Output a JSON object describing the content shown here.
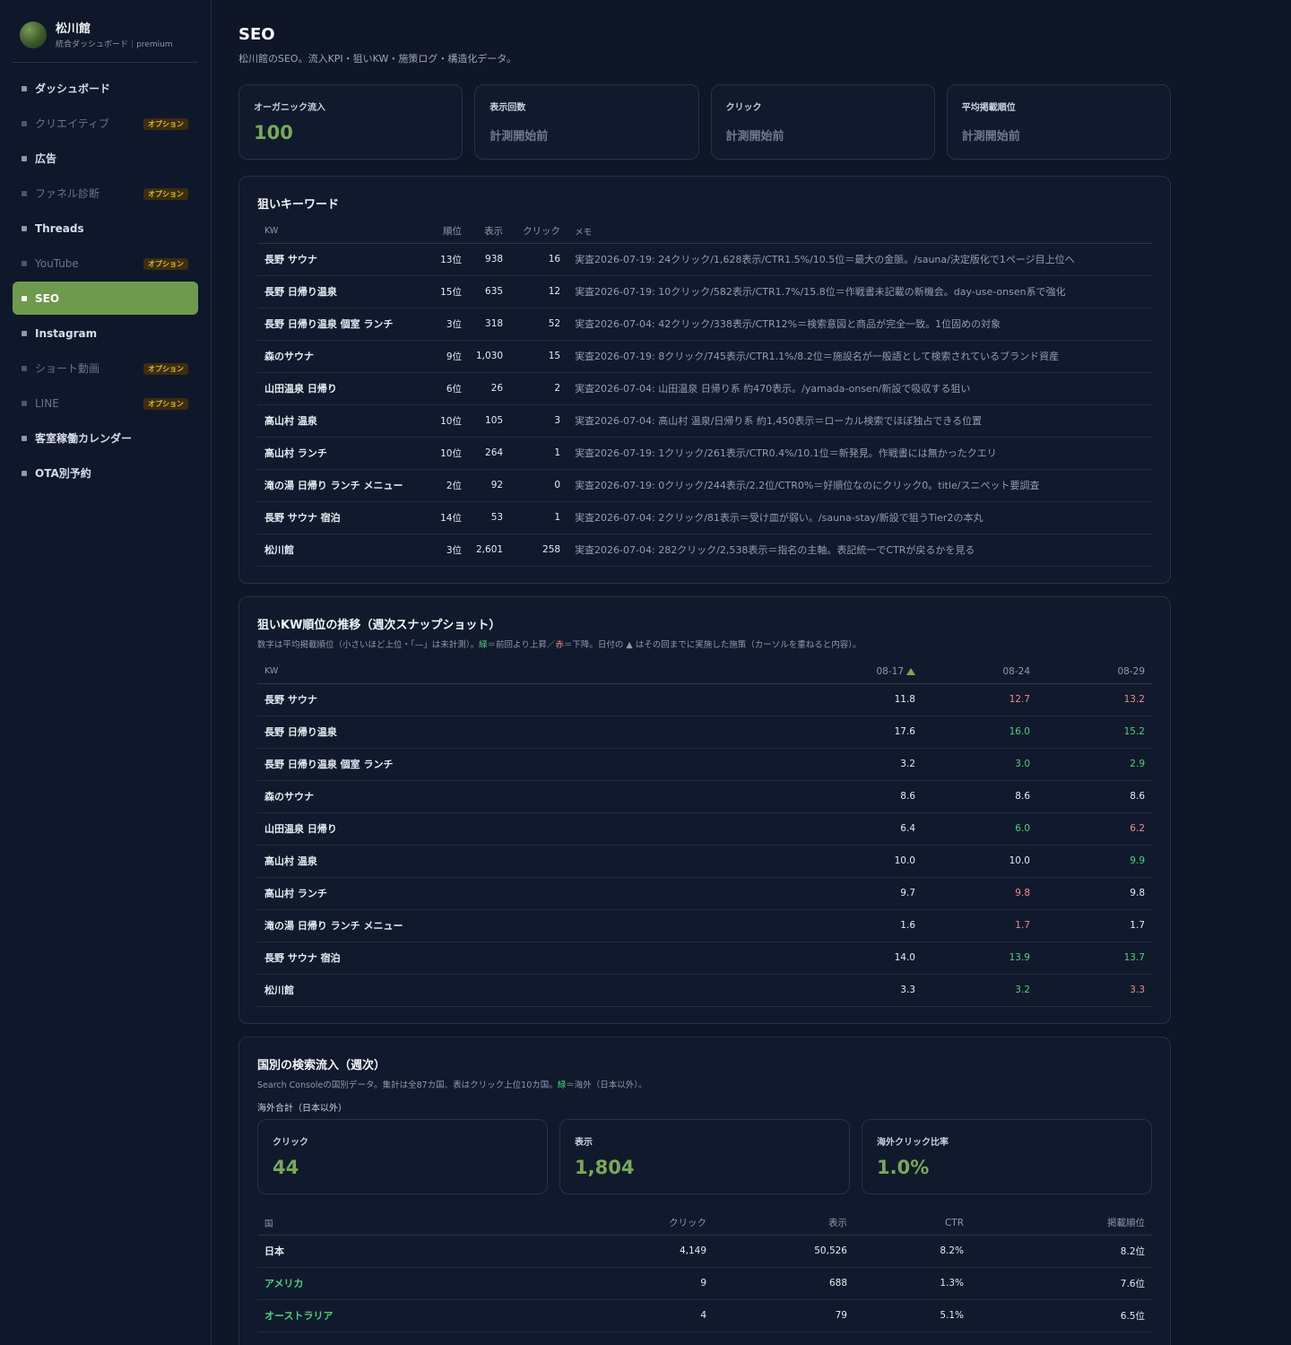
{
  "brand": {
    "name": "松川館",
    "sub": "統合ダッシュボード",
    "plan": "premium"
  },
  "nav": [
    {
      "label": "ダッシュボード",
      "dim": false,
      "active": false
    },
    {
      "label": "クリエイティブ",
      "dim": true,
      "active": false,
      "badge": "オプション"
    },
    {
      "label": "広告",
      "dim": false,
      "active": false
    },
    {
      "label": "ファネル診断",
      "dim": true,
      "active": false,
      "badge": "オプション"
    },
    {
      "label": "Threads",
      "dim": false,
      "active": false
    },
    {
      "label": "YouTube",
      "dim": true,
      "active": false,
      "badge": "オプション"
    },
    {
      "label": "SEO",
      "dim": false,
      "active": true
    },
    {
      "label": "Instagram",
      "dim": false,
      "active": false
    },
    {
      "label": "ショート動画",
      "dim": true,
      "active": false,
      "badge": "オプション"
    },
    {
      "label": "LINE",
      "dim": true,
      "active": false,
      "badge": "オプション"
    },
    {
      "label": "客室稼働カレンダー",
      "dim": false,
      "active": false
    },
    {
      "label": "OTA別予約",
      "dim": false,
      "active": false
    }
  ],
  "page": {
    "title": "SEO",
    "description": "松川館のSEO。流入KPI・狙いKW・施策ログ・構造化データ。"
  },
  "kpis": [
    {
      "label": "オーガニック流入",
      "value": "100",
      "muted": false
    },
    {
      "label": "表示回数",
      "value": "計測開始前",
      "muted": true
    },
    {
      "label": "クリック",
      "value": "計測開始前",
      "muted": true
    },
    {
      "label": "平均掲載順位",
      "value": "計測開始前",
      "muted": true
    }
  ],
  "keywords": {
    "title": "狙いキーワード",
    "headers": {
      "kw": "KW",
      "rank": "順位",
      "impr": "表示",
      "click": "クリック",
      "memo": "メモ"
    },
    "rows": [
      {
        "kw": "長野 サウナ",
        "rank": "13位",
        "impr": "938",
        "click": "16",
        "memo": "実査2026-07-19: 24クリック/1,628表示/CTR1.5%/10.5位＝最大の金脈。/sauna/決定版化で1ページ目上位へ"
      },
      {
        "kw": "長野 日帰り温泉",
        "rank": "15位",
        "impr": "635",
        "click": "12",
        "memo": "実査2026-07-19: 10クリック/582表示/CTR1.7%/15.8位＝作戦書未記載の新機会。day-use-onsen系で強化"
      },
      {
        "kw": "長野 日帰り温泉 個室 ランチ",
        "rank": "3位",
        "impr": "318",
        "click": "52",
        "memo": "実査2026-07-04: 42クリック/338表示/CTR12%＝検索意図と商品が完全一致。1位固めの対象"
      },
      {
        "kw": "森のサウナ",
        "rank": "9位",
        "impr": "1,030",
        "click": "15",
        "memo": "実査2026-07-19: 8クリック/745表示/CTR1.1%/8.2位＝施設名が一般語として検索されているブランド資産"
      },
      {
        "kw": "山田温泉 日帰り",
        "rank": "6位",
        "impr": "26",
        "click": "2",
        "memo": "実査2026-07-04: 山田温泉 日帰り系 約470表示。/yamada-onsen/新設で吸収する狙い"
      },
      {
        "kw": "高山村 温泉",
        "rank": "10位",
        "impr": "105",
        "click": "3",
        "memo": "実査2026-07-04: 高山村 温泉/日帰り系 約1,450表示＝ローカル検索でほぼ独占できる位置"
      },
      {
        "kw": "高山村 ランチ",
        "rank": "10位",
        "impr": "264",
        "click": "1",
        "memo": "実査2026-07-19: 1クリック/261表示/CTR0.4%/10.1位＝新発見。作戦書には無かったクエリ"
      },
      {
        "kw": "滝の湯 日帰り ランチ メニュー",
        "rank": "2位",
        "impr": "92",
        "click": "0",
        "memo": "実査2026-07-19: 0クリック/244表示/2.2位/CTR0%＝好順位なのにクリック0。title/スニペット要調査"
      },
      {
        "kw": "長野 サウナ 宿泊",
        "rank": "14位",
        "impr": "53",
        "click": "1",
        "memo": "実査2026-07-04: 2クリック/81表示＝受け皿が弱い。/sauna-stay/新設で狙うTier2の本丸"
      },
      {
        "kw": "松川館",
        "rank": "3位",
        "impr": "2,601",
        "click": "258",
        "memo": "実査2026-07-04: 282クリック/2,538表示＝指名の主軸。表記統一でCTRが戻るかを見る"
      }
    ]
  },
  "trend": {
    "title": "狙いKW順位の推移（週次スナップショット）",
    "desc_pre": "数字は平均掲載順位（小さいほど上位・「—」は未計測）。",
    "desc_green": "緑",
    "desc_mid": "＝前回より上昇／",
    "desc_red": "赤",
    "desc_post": "＝下降。日付の ▲ はその回までに実施した施策（カーソルを重ねると内容）。",
    "headers": {
      "kw": "KW",
      "d1": "08-17",
      "d2": "08-24",
      "d3": "08-29"
    },
    "rows": [
      {
        "kw": "長野 サウナ",
        "v1": "11.8",
        "v2": "12.7",
        "c2": "down",
        "v3": "13.2",
        "c3": "down"
      },
      {
        "kw": "長野 日帰り温泉",
        "v1": "17.6",
        "v2": "16.0",
        "c2": "up",
        "v3": "15.2",
        "c3": "up"
      },
      {
        "kw": "長野 日帰り温泉 個室 ランチ",
        "v1": "3.2",
        "v2": "3.0",
        "c2": "up",
        "v3": "2.9",
        "c3": "up"
      },
      {
        "kw": "森のサウナ",
        "v1": "8.6",
        "v2": "8.6",
        "c2": "",
        "v3": "8.6",
        "c3": ""
      },
      {
        "kw": "山田温泉 日帰り",
        "v1": "6.4",
        "v2": "6.0",
        "c2": "up",
        "v3": "6.2",
        "c3": "down"
      },
      {
        "kw": "高山村 温泉",
        "v1": "10.0",
        "v2": "10.0",
        "c2": "",
        "v3": "9.9",
        "c3": "up"
      },
      {
        "kw": "高山村 ランチ",
        "v1": "9.7",
        "v2": "9.8",
        "c2": "down",
        "v3": "9.8",
        "c3": ""
      },
      {
        "kw": "滝の湯 日帰り ランチ メニュー",
        "v1": "1.6",
        "v2": "1.7",
        "c2": "down",
        "v3": "1.7",
        "c3": ""
      },
      {
        "kw": "長野 サウナ 宿泊",
        "v1": "14.0",
        "v2": "13.9",
        "c2": "up",
        "v3": "13.7",
        "c3": "up"
      },
      {
        "kw": "松川館",
        "v1": "3.3",
        "v2": "3.2",
        "c2": "up",
        "v3": "3.3",
        "c3": "down"
      }
    ]
  },
  "country": {
    "title": "国別の検索流入（週次）",
    "desc_pre": "Search Consoleの国別データ。集計は全87カ国、表はクリック上位10カ国。",
    "desc_green": "緑",
    "desc_post": "＝海外（日本以外）。",
    "overseas_label": "海外合計（日本以外）",
    "kpis": [
      {
        "label": "クリック",
        "value": "44"
      },
      {
        "label": "表示",
        "value": "1,804"
      },
      {
        "label": "海外クリック比率",
        "value": "1.0%"
      }
    ],
    "headers": {
      "country": "国",
      "click": "クリック",
      "impr": "表示",
      "ctr": "CTR",
      "pos": "掲載順位"
    },
    "rows": [
      {
        "country": "日本",
        "overseas": false,
        "click": "4,149",
        "impr": "50,526",
        "ctr": "8.2%",
        "pos": "8.2位"
      },
      {
        "country": "アメリカ",
        "overseas": true,
        "click": "9",
        "impr": "688",
        "ctr": "1.3%",
        "pos": "7.6位"
      },
      {
        "country": "オーストラリア",
        "overseas": true,
        "click": "4",
        "impr": "79",
        "ctr": "5.1%",
        "pos": "6.5位"
      }
    ]
  }
}
